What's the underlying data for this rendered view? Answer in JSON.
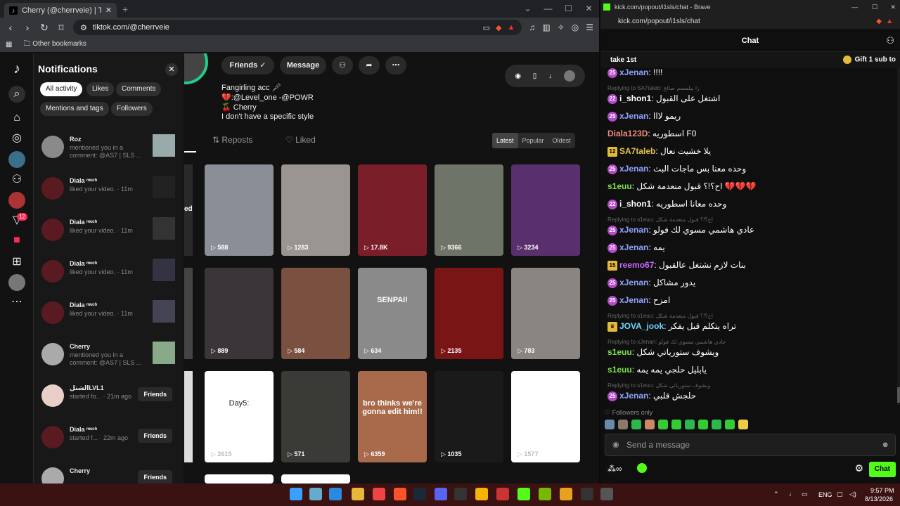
{
  "browser_left": {
    "tab_title": "Cherry (@cherrveie) | TikTok",
    "url": "tiktok.com/@cherrveie",
    "bookmarks_label": "Other bookmarks"
  },
  "notifications": {
    "title": "Notifications",
    "filters": [
      "All activity",
      "Likes",
      "Comments",
      "Mentions and tags",
      "Followers"
    ],
    "rail_badge": "12",
    "items": [
      {
        "name": "Roz",
        "text": "mentioned you in a comment: @AS7 | SLS ...",
        "kind": "thumb"
      },
      {
        "name": "Diala ᵐᵘᶜʰ",
        "text": "liked your video. · 11m",
        "kind": "thumb"
      },
      {
        "name": "Diala ᵐᵘᶜʰ",
        "text": "liked your video. · 11m",
        "kind": "thumb"
      },
      {
        "name": "Diala ᵐᵘᶜʰ",
        "text": "liked your video. · 11m",
        "kind": "thumb"
      },
      {
        "name": "Diala ᵐᵘᶜʰ",
        "text": "liked your video. · 11m",
        "kind": "thumb"
      },
      {
        "name": "Cherry",
        "text": "mentioned you in a comment: @AS7 | SLS ...",
        "kind": "thumb"
      },
      {
        "name": "الشتلLVL1",
        "text": "started fo... · 21m ago",
        "kind": "button",
        "button": "Friends"
      },
      {
        "name": "Diala ᵐᵘᶜʰ",
        "text": "started f... · 22m ago",
        "kind": "button",
        "button": "Friends"
      },
      {
        "name": "Cherry",
        "text": "",
        "kind": "button",
        "button": "Friends"
      }
    ]
  },
  "profile": {
    "friends_label": "Friends ✓",
    "message_label": "Message",
    "bio": [
      "Fangirling acc 🩼",
      "💔:@Level_one -@POWR",
      "🍒 Cherry",
      "I don't have a specific style"
    ],
    "tabs": [
      "⇅ Reposts",
      "♡ Liked"
    ],
    "sort": [
      "Latest",
      "Popular",
      "Oldest"
    ],
    "partial_label": "ed",
    "videos": [
      {
        "count": "588",
        "color": "#8a8f97"
      },
      {
        "count": "1283",
        "color": "#9a9590"
      },
      {
        "count": "17.8K",
        "color": "#7a1f2a"
      },
      {
        "count": "9366",
        "color": "#6f7468"
      },
      {
        "count": "3234",
        "color": "#5a2f6e"
      },
      {
        "count": "889",
        "color": "#3a3538"
      },
      {
        "count": "584",
        "color": "#7a5040"
      },
      {
        "count": "634",
        "color": "#8a8a8a",
        "overlay": "SENPAI!"
      },
      {
        "count": "2135",
        "color": "#7a1515"
      },
      {
        "count": "783",
        "color": "#8a8580"
      },
      {
        "count": "2615",
        "color": "#ffffff",
        "overlay": "Day5:"
      },
      {
        "count": "571",
        "color": "#3a3a36"
      },
      {
        "count": "6359",
        "color": "#a86a4a",
        "overlay": "bro thinks we're gonna edit him!!"
      },
      {
        "count": "1035",
        "color": "#1a1a1a"
      },
      {
        "count": "1577",
        "color": "#ffffff"
      }
    ]
  },
  "kick": {
    "window_title": "kick.com/popout/i1sls/chat - Brave",
    "url": "kick.com/popout/i1sls/chat",
    "chat_title": "Chat",
    "pinned_left": "take 1st",
    "pinned_right": "Gift 1 sub to",
    "messages": [
      {
        "badge": "25",
        "badge_color": "#b44ac9",
        "user": "xJenan",
        "color": "#8ea3ff",
        "text": "!!!!"
      },
      {
        "reply": "Replying to SA7taleb: زا بيلمسم صالح"
      },
      {
        "badge": "22",
        "badge_color": "#b44ac9",
        "user": "i_shon1",
        "color": "#ffffff",
        "text": "اشتغل على القبول"
      },
      {
        "badge": "25",
        "badge_color": "#b44ac9",
        "user": "xJenan",
        "color": "#8ea3ff",
        "text": "ريمو لااا"
      },
      {
        "user": "Diala123D",
        "color": "#f08a7a",
        "text": "اسطوريه F0"
      },
      {
        "badge": "12",
        "badge_color": "#e5b93a",
        "user": "SA7taleb",
        "color": "#e5c04a",
        "text": "يلا خشيت نعال"
      },
      {
        "badge": "25",
        "badge_color": "#b44ac9",
        "user": "xJenan",
        "color": "#8ea3ff",
        "text": "وحده معنا بس ماجات البث"
      },
      {
        "user": "s1euu",
        "color": "#7ee04a",
        "text": "اح؟!؟ قبول منعدمة شكل 💔💔💔"
      },
      {
        "badge": "22",
        "badge_color": "#b44ac9",
        "user": "i_shon1",
        "color": "#ffffff",
        "text": "وحده معانا اسطوريه"
      },
      {
        "reply": "Replying to s1euu: اح؟!؟ قبول منعدمة شكل"
      },
      {
        "badge": "25",
        "badge_color": "#b44ac9",
        "user": "xJenan",
        "color": "#8ea3ff",
        "text": "عادي هاشمي مسوي لك فولو"
      },
      {
        "badge": "25",
        "badge_color": "#b44ac9",
        "user": "xJenan",
        "color": "#8ea3ff",
        "text": "يمه"
      },
      {
        "badge": "15",
        "badge_color": "#e5b93a",
        "user": "reemo67",
        "color": "#c86aff",
        "text": "بنات لازم نشتغل عالقبول"
      },
      {
        "badge": "25",
        "badge_color": "#b44ac9",
        "user": "xJenan",
        "color": "#8ea3ff",
        "text": "يدور مشاكل"
      },
      {
        "badge": "25",
        "badge_color": "#b44ac9",
        "user": "xJenan",
        "color": "#8ea3ff",
        "text": "امزح"
      },
      {
        "reply": "Replying to s1euu: اح؟!؟ قبول منعدمة شكل"
      },
      {
        "badge": "♛",
        "badge_color": "#e5b93a",
        "user": "JOVA_jook",
        "color": "#6fd3ff",
        "text": "تراه يتكلم قبل يفكر"
      },
      {
        "reply": "Replying to xJenan: عادي هاشمي مسوي لك فولو"
      },
      {
        "user": "s1euu",
        "color": "#7ee04a",
        "text": "ويشوف ستورياتي شكل"
      },
      {
        "user": "s1euu",
        "color": "#7ee04a",
        "text": "يابليل حلجي يمه يمه"
      },
      {
        "reply": "Replying to s1euu: ويشوف ستورياتي شكل"
      },
      {
        "badge": "25",
        "badge_color": "#b44ac9",
        "user": "xJenan",
        "color": "#8ea3ff",
        "text": "حلجش قلبي"
      }
    ],
    "followers_only": "♡ Followers only",
    "send_placeholder": "Send a message",
    "chat_button": "Chat"
  },
  "taskbar": {
    "lang": "ENG",
    "time": "9:57 PM",
    "date": "8/13/2026"
  }
}
